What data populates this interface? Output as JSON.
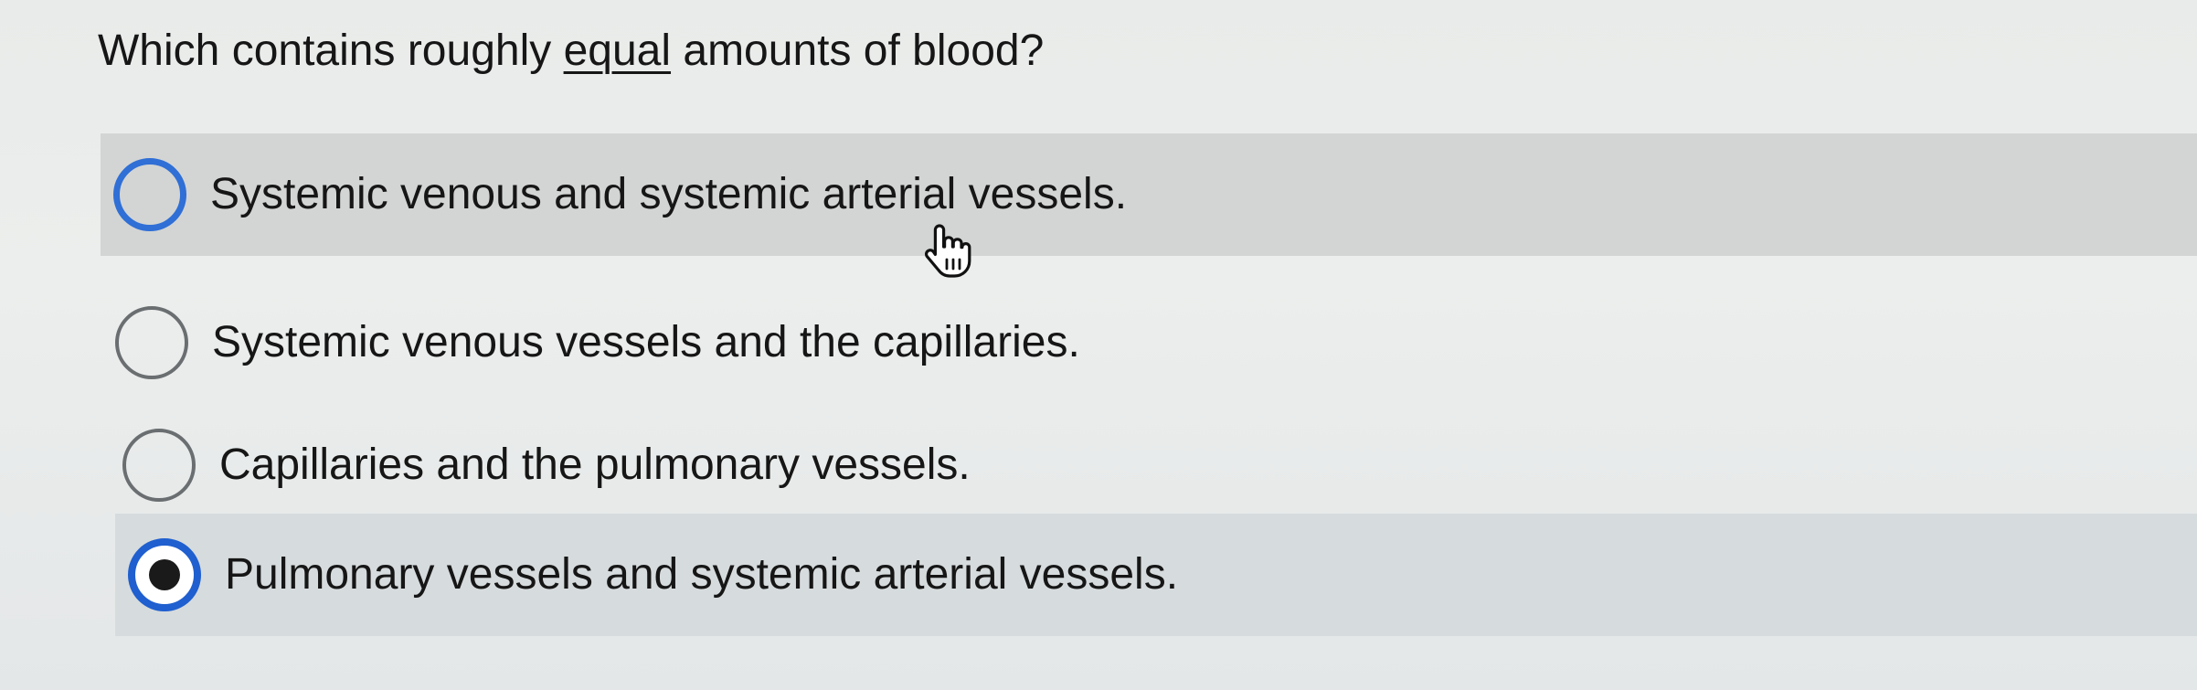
{
  "question": {
    "prefix": "Which contains roughly ",
    "emphasis": "equal",
    "suffix": " amounts of blood?"
  },
  "options": [
    {
      "label": "Systemic venous and systemic arterial vessels.",
      "selected": false,
      "state": "hovered"
    },
    {
      "label": "Systemic venous vessels and the capillaries.",
      "selected": false,
      "state": "default"
    },
    {
      "label": "Capillaries and the pulmonary vessels.",
      "selected": false,
      "state": "default"
    },
    {
      "label": "Pulmonary vessels and systemic arterial vessels.",
      "selected": true,
      "state": "selected"
    }
  ],
  "cursor": {
    "icon": "hand-pointer-icon"
  },
  "colors": {
    "radio_accent": "#2f6fd6",
    "hover_row": "#d3d5d4",
    "selected_row": "#d6dbdd",
    "text": "#161616"
  }
}
